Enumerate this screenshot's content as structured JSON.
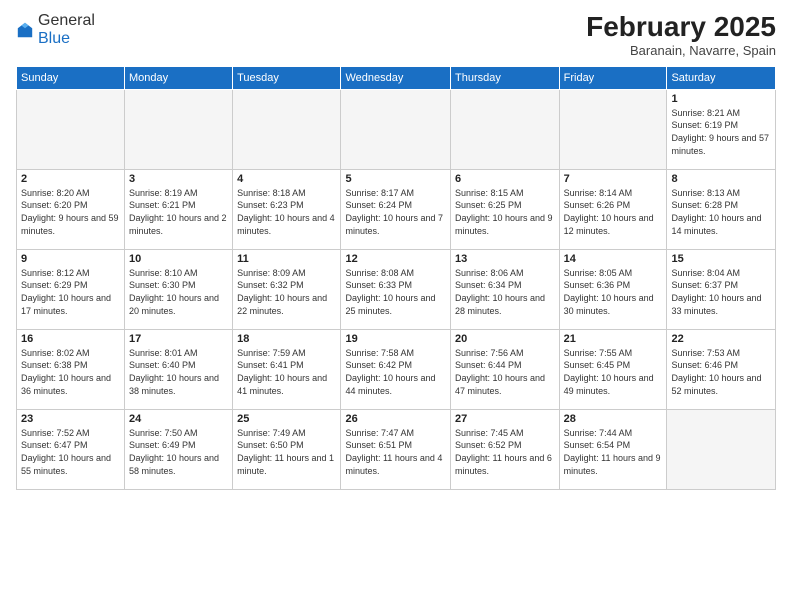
{
  "header": {
    "logo_general": "General",
    "logo_blue": "Blue",
    "month_title": "February 2025",
    "location": "Baranain, Navarre, Spain"
  },
  "days_of_week": [
    "Sunday",
    "Monday",
    "Tuesday",
    "Wednesday",
    "Thursday",
    "Friday",
    "Saturday"
  ],
  "weeks": [
    [
      {
        "day": "",
        "info": ""
      },
      {
        "day": "",
        "info": ""
      },
      {
        "day": "",
        "info": ""
      },
      {
        "day": "",
        "info": ""
      },
      {
        "day": "",
        "info": ""
      },
      {
        "day": "",
        "info": ""
      },
      {
        "day": "1",
        "info": "Sunrise: 8:21 AM\nSunset: 6:19 PM\nDaylight: 9 hours and 57 minutes."
      }
    ],
    [
      {
        "day": "2",
        "info": "Sunrise: 8:20 AM\nSunset: 6:20 PM\nDaylight: 9 hours and 59 minutes."
      },
      {
        "day": "3",
        "info": "Sunrise: 8:19 AM\nSunset: 6:21 PM\nDaylight: 10 hours and 2 minutes."
      },
      {
        "day": "4",
        "info": "Sunrise: 8:18 AM\nSunset: 6:23 PM\nDaylight: 10 hours and 4 minutes."
      },
      {
        "day": "5",
        "info": "Sunrise: 8:17 AM\nSunset: 6:24 PM\nDaylight: 10 hours and 7 minutes."
      },
      {
        "day": "6",
        "info": "Sunrise: 8:15 AM\nSunset: 6:25 PM\nDaylight: 10 hours and 9 minutes."
      },
      {
        "day": "7",
        "info": "Sunrise: 8:14 AM\nSunset: 6:26 PM\nDaylight: 10 hours and 12 minutes."
      },
      {
        "day": "8",
        "info": "Sunrise: 8:13 AM\nSunset: 6:28 PM\nDaylight: 10 hours and 14 minutes."
      }
    ],
    [
      {
        "day": "9",
        "info": "Sunrise: 8:12 AM\nSunset: 6:29 PM\nDaylight: 10 hours and 17 minutes."
      },
      {
        "day": "10",
        "info": "Sunrise: 8:10 AM\nSunset: 6:30 PM\nDaylight: 10 hours and 20 minutes."
      },
      {
        "day": "11",
        "info": "Sunrise: 8:09 AM\nSunset: 6:32 PM\nDaylight: 10 hours and 22 minutes."
      },
      {
        "day": "12",
        "info": "Sunrise: 8:08 AM\nSunset: 6:33 PM\nDaylight: 10 hours and 25 minutes."
      },
      {
        "day": "13",
        "info": "Sunrise: 8:06 AM\nSunset: 6:34 PM\nDaylight: 10 hours and 28 minutes."
      },
      {
        "day": "14",
        "info": "Sunrise: 8:05 AM\nSunset: 6:36 PM\nDaylight: 10 hours and 30 minutes."
      },
      {
        "day": "15",
        "info": "Sunrise: 8:04 AM\nSunset: 6:37 PM\nDaylight: 10 hours and 33 minutes."
      }
    ],
    [
      {
        "day": "16",
        "info": "Sunrise: 8:02 AM\nSunset: 6:38 PM\nDaylight: 10 hours and 36 minutes."
      },
      {
        "day": "17",
        "info": "Sunrise: 8:01 AM\nSunset: 6:40 PM\nDaylight: 10 hours and 38 minutes."
      },
      {
        "day": "18",
        "info": "Sunrise: 7:59 AM\nSunset: 6:41 PM\nDaylight: 10 hours and 41 minutes."
      },
      {
        "day": "19",
        "info": "Sunrise: 7:58 AM\nSunset: 6:42 PM\nDaylight: 10 hours and 44 minutes."
      },
      {
        "day": "20",
        "info": "Sunrise: 7:56 AM\nSunset: 6:44 PM\nDaylight: 10 hours and 47 minutes."
      },
      {
        "day": "21",
        "info": "Sunrise: 7:55 AM\nSunset: 6:45 PM\nDaylight: 10 hours and 49 minutes."
      },
      {
        "day": "22",
        "info": "Sunrise: 7:53 AM\nSunset: 6:46 PM\nDaylight: 10 hours and 52 minutes."
      }
    ],
    [
      {
        "day": "23",
        "info": "Sunrise: 7:52 AM\nSunset: 6:47 PM\nDaylight: 10 hours and 55 minutes."
      },
      {
        "day": "24",
        "info": "Sunrise: 7:50 AM\nSunset: 6:49 PM\nDaylight: 10 hours and 58 minutes."
      },
      {
        "day": "25",
        "info": "Sunrise: 7:49 AM\nSunset: 6:50 PM\nDaylight: 11 hours and 1 minute."
      },
      {
        "day": "26",
        "info": "Sunrise: 7:47 AM\nSunset: 6:51 PM\nDaylight: 11 hours and 4 minutes."
      },
      {
        "day": "27",
        "info": "Sunrise: 7:45 AM\nSunset: 6:52 PM\nDaylight: 11 hours and 6 minutes."
      },
      {
        "day": "28",
        "info": "Sunrise: 7:44 AM\nSunset: 6:54 PM\nDaylight: 11 hours and 9 minutes."
      },
      {
        "day": "",
        "info": ""
      }
    ]
  ]
}
